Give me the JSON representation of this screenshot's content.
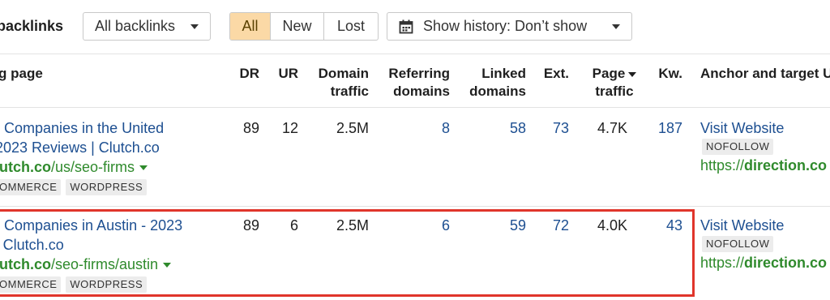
{
  "toolbar": {
    "title": "backlinks",
    "filter_dropdown": "All backlinks",
    "segments": [
      {
        "label": "All",
        "active": true
      },
      {
        "label": "New",
        "active": false
      },
      {
        "label": "Lost",
        "active": false
      }
    ],
    "history_dropdown": "Show history: Don’t show"
  },
  "columns": {
    "referring_page": "g page",
    "dr": "DR",
    "ur": "UR",
    "domain_traffic": [
      "Domain",
      "traffic"
    ],
    "referring_domains": [
      "Referring",
      "domains"
    ],
    "linked_domains": [
      "Linked",
      "domains"
    ],
    "ext": "Ext.",
    "page_traffic": [
      "Page",
      "traffic"
    ],
    "kw": "Kw.",
    "anchor": "Anchor and target U"
  },
  "rows": [
    {
      "title_lines": [
        ") Companies in the United",
        " 2023 Reviews | Clutch.co"
      ],
      "url_domain": "lutch.co",
      "url_path": "/us/seo-firms",
      "tags": [
        "OMMERCE",
        "WORDPRESS"
      ],
      "dr": "89",
      "ur": "12",
      "domain_traffic": "2.5M",
      "referring_domains": "8",
      "linked_domains": "58",
      "ext": "73",
      "page_traffic": "4.7K",
      "kw": "187",
      "anchor_text": "Visit Website",
      "anchor_tag": "NOFOLLOW",
      "target_prefix": "https://",
      "target_domain": "direction.co"
    },
    {
      "title_lines": [
        ") Companies in Austin - 2023",
        " | Clutch.co"
      ],
      "url_domain": "lutch.co",
      "url_path": "/seo-firms/austin",
      "tags": [
        "OMMERCE",
        "WORDPRESS"
      ],
      "dr": "89",
      "ur": "6",
      "domain_traffic": "2.5M",
      "referring_domains": "6",
      "linked_domains": "59",
      "ext": "72",
      "page_traffic": "4.0K",
      "kw": "43",
      "anchor_text": "Visit Website",
      "anchor_tag": "NOFOLLOW",
      "target_prefix": "https://",
      "target_domain": "direction.co"
    }
  ],
  "icons": {
    "calendar": "calendar-icon",
    "caret": "chevron-down-icon"
  },
  "colors": {
    "active_segment": "#fbd9a6",
    "link": "#1d4f91",
    "url": "#2f8a2c",
    "highlight_box": "#e0352b"
  }
}
